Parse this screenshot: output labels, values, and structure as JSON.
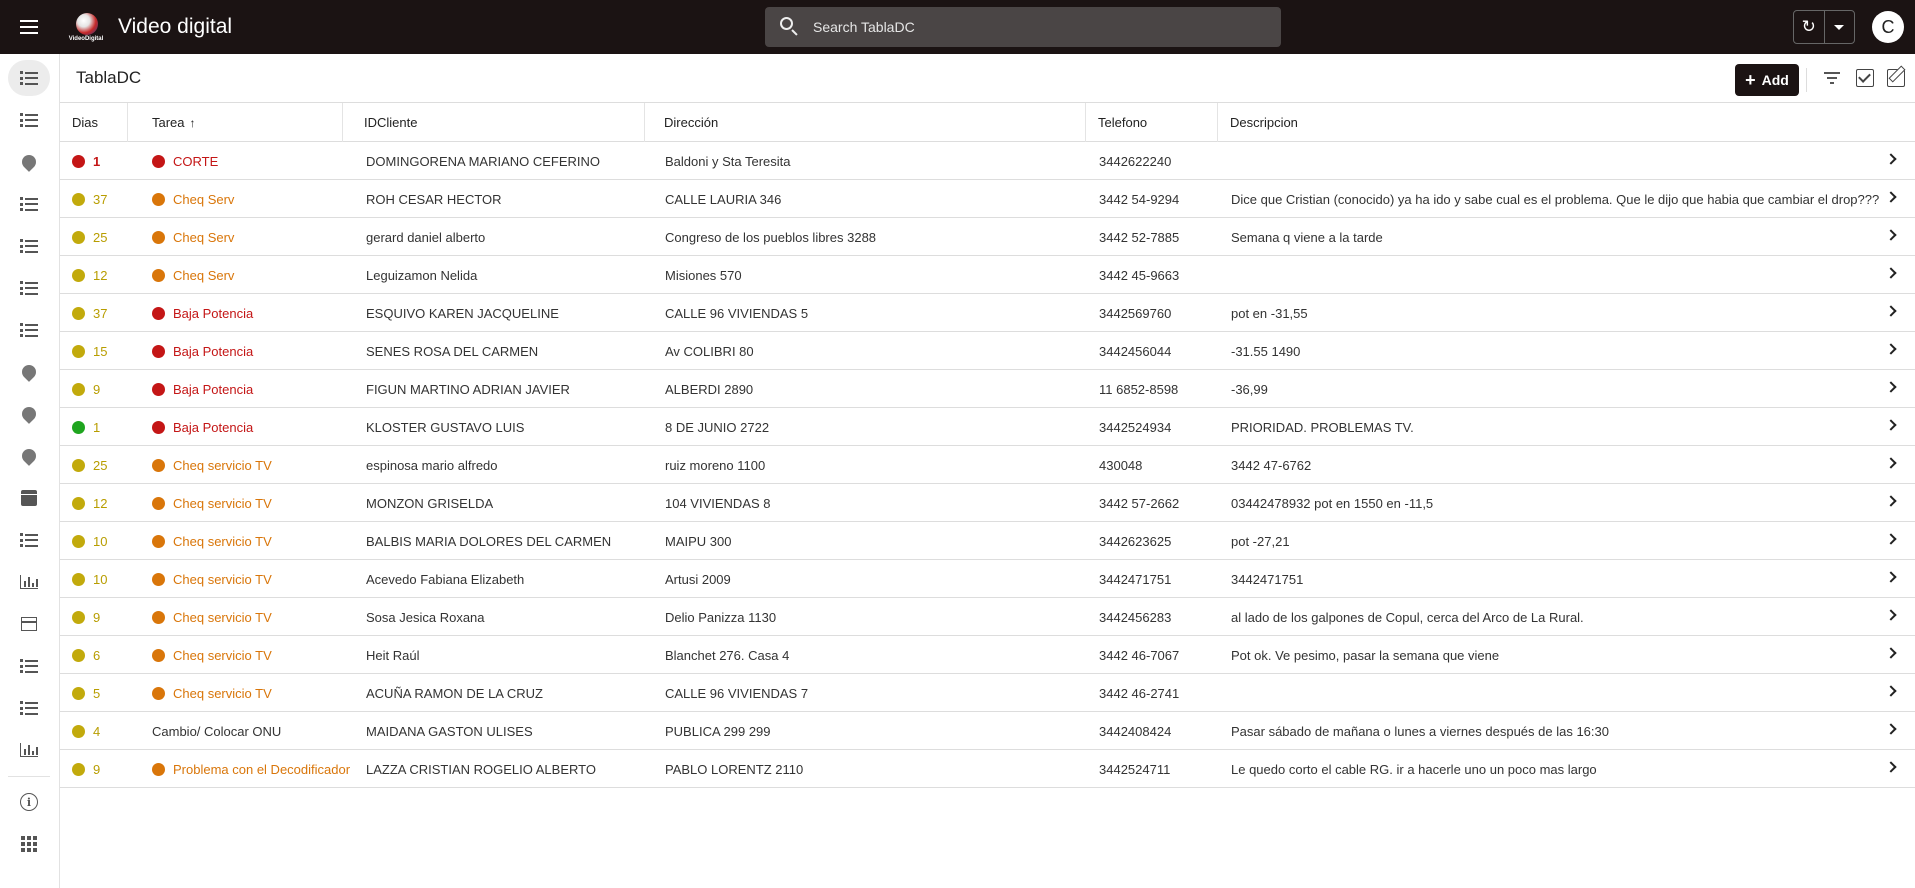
{
  "app": {
    "title": "Video digital",
    "logo_text": "VideoDigital",
    "avatar_letter": "C"
  },
  "search": {
    "placeholder": "Search TablaDC"
  },
  "page": {
    "title": "TablaDC",
    "add_label": "Add"
  },
  "table": {
    "columns": [
      "Dias",
      "Tarea",
      "IDCliente",
      "Dirección",
      "Telefono",
      "Descripcion"
    ],
    "sort_arrow": "↑",
    "rows": [
      {
        "dias": "1",
        "dias_color": "#c41616",
        "dias_class": "red",
        "tarea": "CORTE",
        "tarea_color": "#c41616",
        "tarea_class": "red",
        "cliente": "DOMINGORENA MARIANO CEFERINO",
        "direccion": "Baldoni y Sta Teresita",
        "telefono": "3442622240",
        "descripcion": ""
      },
      {
        "dias": "37",
        "dias_color": "#c2aa0c",
        "dias_class": "olive",
        "tarea": "Cheq Serv",
        "tarea_color": "#d9760a",
        "tarea_class": "orange",
        "cliente": "ROH CESAR HECTOR",
        "direccion": "CALLE LAURIA 346",
        "telefono": "3442 54-9294",
        "descripcion": "Dice que Cristian (conocido) ya ha ido y sabe cual es el problema. Que le dijo que habia que cambiar el drop???"
      },
      {
        "dias": "25",
        "dias_color": "#c2aa0c",
        "dias_class": "olive",
        "tarea": "Cheq Serv",
        "tarea_color": "#d9760a",
        "tarea_class": "orange",
        "cliente": "gerard daniel alberto",
        "direccion": "Congreso de los pueblos libres 3288",
        "telefono": "3442 52-7885",
        "descripcion": "Semana q viene a la tarde"
      },
      {
        "dias": "12",
        "dias_color": "#c2aa0c",
        "dias_class": "olive",
        "tarea": "Cheq Serv",
        "tarea_color": "#d9760a",
        "tarea_class": "orange",
        "cliente": "Leguizamon Nelida",
        "direccion": "Misiones 570",
        "telefono": "3442 45-9663",
        "descripcion": ""
      },
      {
        "dias": "37",
        "dias_color": "#c2aa0c",
        "dias_class": "olive",
        "tarea": "Baja Potencia",
        "tarea_color": "#c41616",
        "tarea_class": "red",
        "cliente": "ESQUIVO KAREN JACQUELINE",
        "direccion": "CALLE 96 VIVIENDAS 5",
        "telefono": "3442569760",
        "descripcion": "pot en -31,55"
      },
      {
        "dias": "15",
        "dias_color": "#c2aa0c",
        "dias_class": "olive",
        "tarea": "Baja Potencia",
        "tarea_color": "#c41616",
        "tarea_class": "red",
        "cliente": "SENES ROSA DEL CARMEN",
        "direccion": "Av COLIBRI 80",
        "telefono": "3442456044",
        "descripcion": "-31.55 1490"
      },
      {
        "dias": "9",
        "dias_color": "#c2aa0c",
        "dias_class": "olive",
        "tarea": "Baja Potencia",
        "tarea_color": "#c41616",
        "tarea_class": "red",
        "cliente": "FIGUN MARTINO ADRIAN JAVIER",
        "direccion": "ALBERDI 2890",
        "telefono": "11 6852-8598",
        "descripcion": "-36,99"
      },
      {
        "dias": "1",
        "dias_color": "#1fa51f",
        "dias_class": "olive",
        "tarea": "Baja Potencia",
        "tarea_color": "#c41616",
        "tarea_class": "red",
        "cliente": "KLOSTER GUSTAVO LUIS",
        "direccion": "8 DE JUNIO 2722",
        "telefono": "3442524934",
        "descripcion": "PRIORIDAD. PROBLEMAS TV."
      },
      {
        "dias": "25",
        "dias_color": "#c2aa0c",
        "dias_class": "olive",
        "tarea": "Cheq servicio TV",
        "tarea_color": "#d9760a",
        "tarea_class": "orange",
        "cliente": "espinosa mario alfredo",
        "direccion": "ruiz moreno 1100",
        "telefono": "430048",
        "descripcion": "3442 47-6762"
      },
      {
        "dias": "12",
        "dias_color": "#c2aa0c",
        "dias_class": "olive",
        "tarea": "Cheq servicio TV",
        "tarea_color": "#d9760a",
        "tarea_class": "orange",
        "cliente": "MONZON GRISELDA",
        "direccion": "104 VIVIENDAS 8",
        "telefono": "3442 57-2662",
        "descripcion": "03442478932 pot en 1550 en -11,5"
      },
      {
        "dias": "10",
        "dias_color": "#c2aa0c",
        "dias_class": "olive",
        "tarea": "Cheq servicio TV",
        "tarea_color": "#d9760a",
        "tarea_class": "orange",
        "cliente": "BALBIS MARIA DOLORES DEL CARMEN",
        "direccion": "MAIPU 300",
        "telefono": "3442623625",
        "descripcion": "pot -27,21"
      },
      {
        "dias": "10",
        "dias_color": "#c2aa0c",
        "dias_class": "olive",
        "tarea": "Cheq servicio TV",
        "tarea_color": "#d9760a",
        "tarea_class": "orange",
        "cliente": "Acevedo Fabiana Elizabeth",
        "direccion": "Artusi 2009",
        "telefono": "3442471751",
        "descripcion": "3442471751"
      },
      {
        "dias": "9",
        "dias_color": "#c2aa0c",
        "dias_class": "olive",
        "tarea": "Cheq servicio TV",
        "tarea_color": "#d9760a",
        "tarea_class": "orange",
        "cliente": "Sosa Jesica Roxana",
        "direccion": "Delio Panizza 1130",
        "telefono": "3442456283",
        "descripcion": "al lado de los galpones de Copul, cerca del Arco de La Rural."
      },
      {
        "dias": "6",
        "dias_color": "#c2aa0c",
        "dias_class": "olive",
        "tarea": "Cheq servicio TV",
        "tarea_color": "#d9760a",
        "tarea_class": "orange",
        "cliente": "Heit Raúl",
        "direccion": "Blanchet 276. Casa 4",
        "telefono": "3442 46-7067",
        "descripcion": "Pot ok. Ve pesimo, pasar la semana que viene"
      },
      {
        "dias": "5",
        "dias_color": "#c2aa0c",
        "dias_class": "olive",
        "tarea": "Cheq servicio TV",
        "tarea_color": "#d9760a",
        "tarea_class": "orange",
        "cliente": "ACUÑA RAMON DE LA CRUZ",
        "direccion": "CALLE 96 VIVIENDAS 7",
        "telefono": "3442 46-2741",
        "descripcion": ""
      },
      {
        "dias": "4",
        "dias_color": "#c2aa0c",
        "dias_class": "olive",
        "tarea": "Cambio/ Colocar ONU",
        "tarea_color": "",
        "tarea_class": "dark",
        "cliente": "MAIDANA GASTON ULISES",
        "direccion": "PUBLICA 299 299",
        "telefono": "3442408424",
        "descripcion": "Pasar sábado de mañana o lunes a viernes después de las 16:30"
      },
      {
        "dias": "9",
        "dias_color": "#c2aa0c",
        "dias_class": "olive",
        "tarea": "Problema con el Decodificador",
        "tarea_color": "#d9760a",
        "tarea_class": "orange",
        "cliente": "LAZZA CRISTIAN ROGELIO ALBERTO",
        "direccion": "PABLO LORENTZ 2110",
        "telefono": "3442524711",
        "descripcion": "Le quedo corto el cable RG. ir a hacerle uno un poco mas largo"
      }
    ]
  }
}
